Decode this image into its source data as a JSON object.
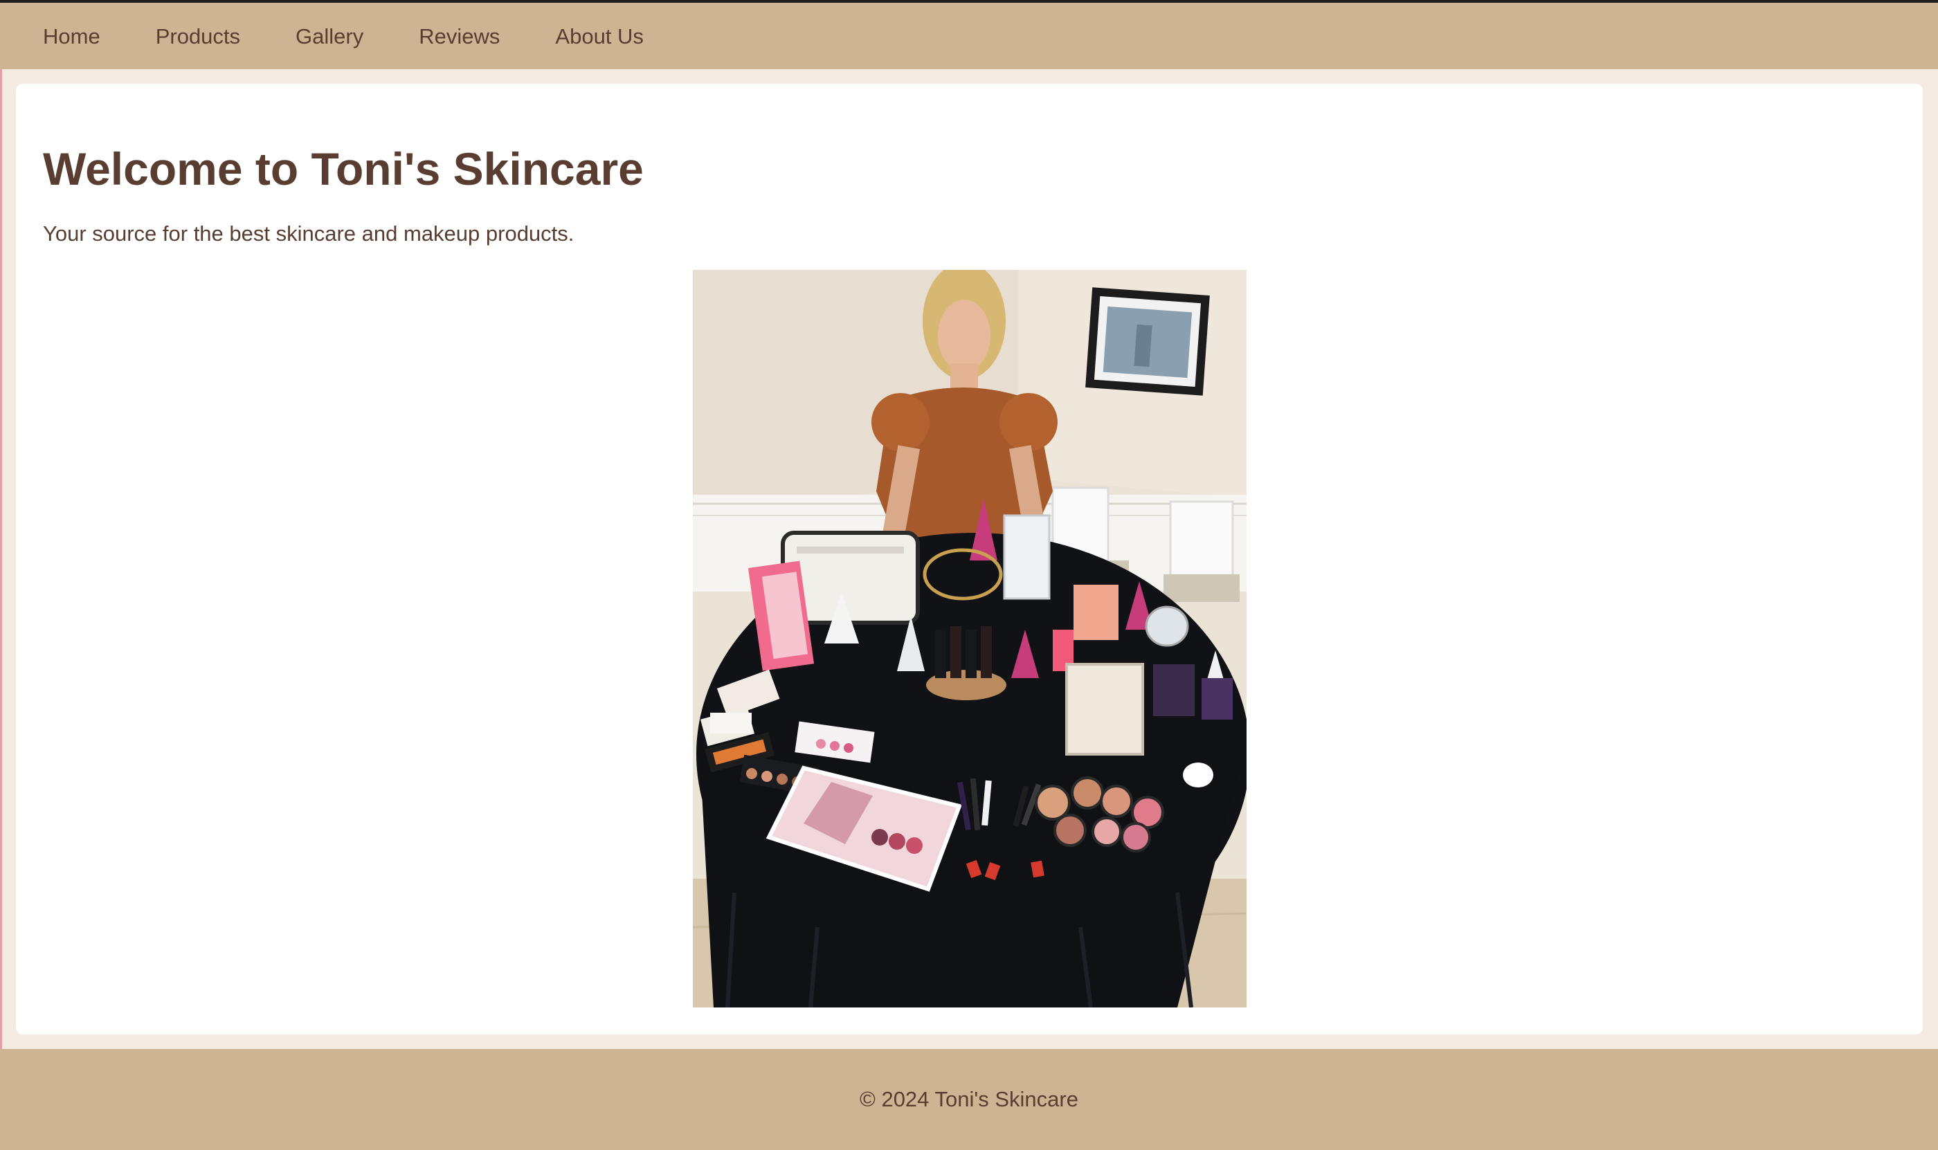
{
  "nav": {
    "items": [
      {
        "label": "Home"
      },
      {
        "label": "Products"
      },
      {
        "label": "Gallery"
      },
      {
        "label": "Reviews"
      },
      {
        "label": "About Us"
      }
    ]
  },
  "hero": {
    "title": "Welcome to Toni's Skincare",
    "subtitle": "Your source for the best skincare and makeup products."
  },
  "footer": {
    "copyright": "© 2024 Toni's Skincare"
  },
  "colors": {
    "nav_background": "#cdb593",
    "page_background": "#f3ebe1",
    "card_background": "#ffffff",
    "text": "#5a3d31"
  }
}
